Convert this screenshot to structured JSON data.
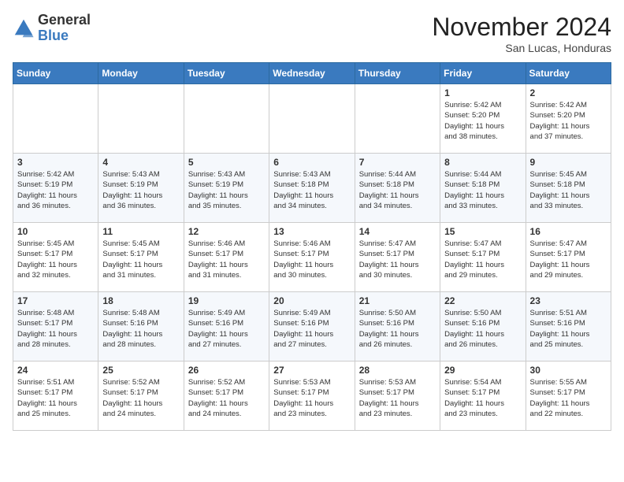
{
  "logo": {
    "general": "General",
    "blue": "Blue"
  },
  "title": "November 2024",
  "subtitle": "San Lucas, Honduras",
  "days_of_week": [
    "Sunday",
    "Monday",
    "Tuesday",
    "Wednesday",
    "Thursday",
    "Friday",
    "Saturday"
  ],
  "weeks": [
    [
      {
        "day": "",
        "detail": ""
      },
      {
        "day": "",
        "detail": ""
      },
      {
        "day": "",
        "detail": ""
      },
      {
        "day": "",
        "detail": ""
      },
      {
        "day": "",
        "detail": ""
      },
      {
        "day": "1",
        "detail": "Sunrise: 5:42 AM\nSunset: 5:20 PM\nDaylight: 11 hours\nand 38 minutes."
      },
      {
        "day": "2",
        "detail": "Sunrise: 5:42 AM\nSunset: 5:20 PM\nDaylight: 11 hours\nand 37 minutes."
      }
    ],
    [
      {
        "day": "3",
        "detail": "Sunrise: 5:42 AM\nSunset: 5:19 PM\nDaylight: 11 hours\nand 36 minutes."
      },
      {
        "day": "4",
        "detail": "Sunrise: 5:43 AM\nSunset: 5:19 PM\nDaylight: 11 hours\nand 36 minutes."
      },
      {
        "day": "5",
        "detail": "Sunrise: 5:43 AM\nSunset: 5:19 PM\nDaylight: 11 hours\nand 35 minutes."
      },
      {
        "day": "6",
        "detail": "Sunrise: 5:43 AM\nSunset: 5:18 PM\nDaylight: 11 hours\nand 34 minutes."
      },
      {
        "day": "7",
        "detail": "Sunrise: 5:44 AM\nSunset: 5:18 PM\nDaylight: 11 hours\nand 34 minutes."
      },
      {
        "day": "8",
        "detail": "Sunrise: 5:44 AM\nSunset: 5:18 PM\nDaylight: 11 hours\nand 33 minutes."
      },
      {
        "day": "9",
        "detail": "Sunrise: 5:45 AM\nSunset: 5:18 PM\nDaylight: 11 hours\nand 33 minutes."
      }
    ],
    [
      {
        "day": "10",
        "detail": "Sunrise: 5:45 AM\nSunset: 5:17 PM\nDaylight: 11 hours\nand 32 minutes."
      },
      {
        "day": "11",
        "detail": "Sunrise: 5:45 AM\nSunset: 5:17 PM\nDaylight: 11 hours\nand 31 minutes."
      },
      {
        "day": "12",
        "detail": "Sunrise: 5:46 AM\nSunset: 5:17 PM\nDaylight: 11 hours\nand 31 minutes."
      },
      {
        "day": "13",
        "detail": "Sunrise: 5:46 AM\nSunset: 5:17 PM\nDaylight: 11 hours\nand 30 minutes."
      },
      {
        "day": "14",
        "detail": "Sunrise: 5:47 AM\nSunset: 5:17 PM\nDaylight: 11 hours\nand 30 minutes."
      },
      {
        "day": "15",
        "detail": "Sunrise: 5:47 AM\nSunset: 5:17 PM\nDaylight: 11 hours\nand 29 minutes."
      },
      {
        "day": "16",
        "detail": "Sunrise: 5:47 AM\nSunset: 5:17 PM\nDaylight: 11 hours\nand 29 minutes."
      }
    ],
    [
      {
        "day": "17",
        "detail": "Sunrise: 5:48 AM\nSunset: 5:17 PM\nDaylight: 11 hours\nand 28 minutes."
      },
      {
        "day": "18",
        "detail": "Sunrise: 5:48 AM\nSunset: 5:16 PM\nDaylight: 11 hours\nand 28 minutes."
      },
      {
        "day": "19",
        "detail": "Sunrise: 5:49 AM\nSunset: 5:16 PM\nDaylight: 11 hours\nand 27 minutes."
      },
      {
        "day": "20",
        "detail": "Sunrise: 5:49 AM\nSunset: 5:16 PM\nDaylight: 11 hours\nand 27 minutes."
      },
      {
        "day": "21",
        "detail": "Sunrise: 5:50 AM\nSunset: 5:16 PM\nDaylight: 11 hours\nand 26 minutes."
      },
      {
        "day": "22",
        "detail": "Sunrise: 5:50 AM\nSunset: 5:16 PM\nDaylight: 11 hours\nand 26 minutes."
      },
      {
        "day": "23",
        "detail": "Sunrise: 5:51 AM\nSunset: 5:16 PM\nDaylight: 11 hours\nand 25 minutes."
      }
    ],
    [
      {
        "day": "24",
        "detail": "Sunrise: 5:51 AM\nSunset: 5:17 PM\nDaylight: 11 hours\nand 25 minutes."
      },
      {
        "day": "25",
        "detail": "Sunrise: 5:52 AM\nSunset: 5:17 PM\nDaylight: 11 hours\nand 24 minutes."
      },
      {
        "day": "26",
        "detail": "Sunrise: 5:52 AM\nSunset: 5:17 PM\nDaylight: 11 hours\nand 24 minutes."
      },
      {
        "day": "27",
        "detail": "Sunrise: 5:53 AM\nSunset: 5:17 PM\nDaylight: 11 hours\nand 23 minutes."
      },
      {
        "day": "28",
        "detail": "Sunrise: 5:53 AM\nSunset: 5:17 PM\nDaylight: 11 hours\nand 23 minutes."
      },
      {
        "day": "29",
        "detail": "Sunrise: 5:54 AM\nSunset: 5:17 PM\nDaylight: 11 hours\nand 23 minutes."
      },
      {
        "day": "30",
        "detail": "Sunrise: 5:55 AM\nSunset: 5:17 PM\nDaylight: 11 hours\nand 22 minutes."
      }
    ]
  ]
}
